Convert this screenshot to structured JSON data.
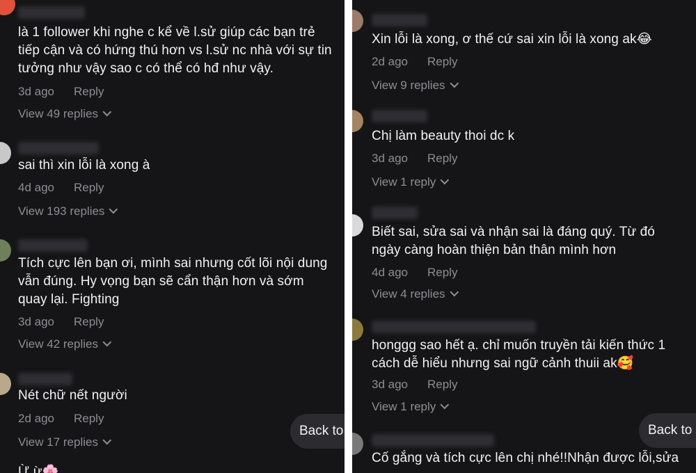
{
  "left_panel": {
    "comments": [
      {
        "text_lines": [
          "là 1 follower khi nghe c kể về l.sử giúp các bạn trẻ",
          "tiếp cận và có hứng thú hơn vs l.sử nc nhà với sự tin",
          "tưởng như vậy sao c có thể có hđ như vậy."
        ],
        "time": "3d ago",
        "reply_label": "Reply",
        "view_replies": "View 49 replies",
        "avatar_color": "#e2513a"
      },
      {
        "text_lines": [
          "sai thì xin lỗi là xong à"
        ],
        "time": "4d ago",
        "reply_label": "Reply",
        "view_replies": "View 193 replies",
        "avatar_color": "#c8c8c8"
      },
      {
        "text_lines": [
          "Tích cực lên bạn ơi, mình sai nhưng cốt lõi nội dung",
          "vẫn đúng. Hy vọng bạn sẽ cẩn thận hơn và sớm",
          "quay lại. Fighting"
        ],
        "time": "3d ago",
        "reply_label": "Reply",
        "view_replies": "View 42 replies",
        "avatar_color": "#6f7f5a"
      },
      {
        "text_lines": [
          "Nét chữ nết người"
        ],
        "time": "2d ago",
        "reply_label": "Reply",
        "view_replies": "View 17 replies",
        "avatar_color": "#b9a98a"
      },
      {
        "text_lines": [
          "Ừ  ừ🌸"
        ],
        "avatar_color": "#444444"
      }
    ],
    "back_to_top": "Back to"
  },
  "right_panel": {
    "comments": [
      {
        "text_lines": [
          "Xin lỗi là xong, ơ thế cứ sai xin lỗi là xong ak😂"
        ],
        "time": "2d ago",
        "reply_label": "Reply",
        "view_replies": "View 9 replies",
        "avatar_color": "#9c7b6a"
      },
      {
        "text_lines": [
          "Chị làm beauty thoi dc k"
        ],
        "time": "3d ago",
        "reply_label": "Reply",
        "view_replies": "View 1 reply",
        "avatar_color": "#a48462"
      },
      {
        "text_lines": [
          "Biết sai, sửa sai và nhận sai là đáng quý. Từ đó",
          "ngày càng hoàn thiện bản thân mình hơn"
        ],
        "time": "4d ago",
        "reply_label": "Reply",
        "view_replies": "View 4 replies",
        "avatar_color": "#d9d9d9"
      },
      {
        "text_lines": [
          "honggg sao hết ạ. chỉ muốn truyền tải kiến thức 1",
          "cách dễ hiểu nhưng sai ngữ cảnh thuii ak🥰"
        ],
        "time": "3d ago",
        "reply_label": "Reply",
        "view_replies": "View 1 reply",
        "avatar_color": "#8c7a3c"
      },
      {
        "text_lines": [
          "Cố gắng và tích cực lên chị nhé!!Nhận được lỗi,sửa"
        ],
        "avatar_color": "#7a7a7a"
      }
    ],
    "back_to_top": "Back to"
  }
}
